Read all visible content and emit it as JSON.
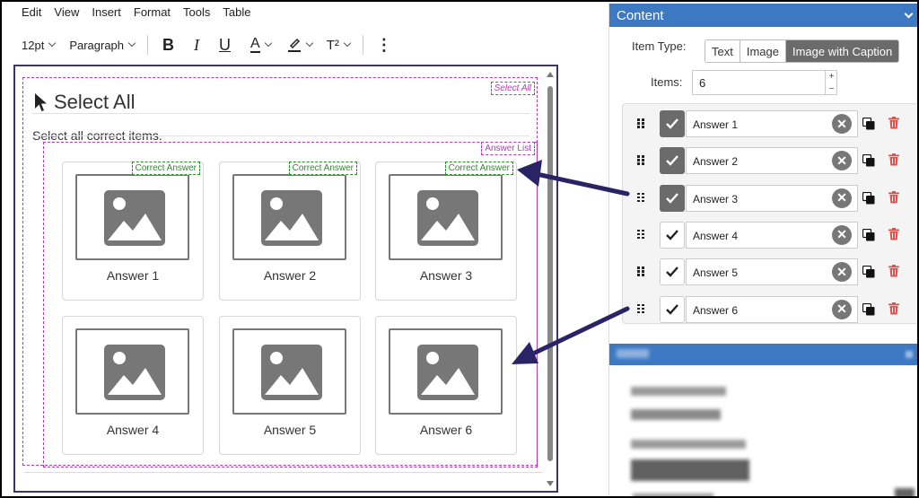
{
  "menu": [
    "Edit",
    "View",
    "Insert",
    "Format",
    "Tools",
    "Table"
  ],
  "toolbar": {
    "font_size": "12pt",
    "block_format": "Paragraph",
    "bold": "B",
    "italic": "I",
    "underline": "U",
    "font_color": "A",
    "superscript": "T²",
    "more": "⋮"
  },
  "editor": {
    "title": "Select All",
    "title_tag": "Select All",
    "prompt": "Select all correct items.",
    "list_tag": "Answer List",
    "correct_tag": "Correct Answer",
    "answers": [
      {
        "caption": "Answer 1",
        "correct": true
      },
      {
        "caption": "Answer 2",
        "correct": true
      },
      {
        "caption": "Answer 3",
        "correct": true
      },
      {
        "caption": "Answer 4",
        "correct": false
      },
      {
        "caption": "Answer 5",
        "correct": false
      },
      {
        "caption": "Answer 6",
        "correct": false
      }
    ]
  },
  "panel": {
    "title": "Content",
    "item_type_label": "Item Type:",
    "item_types": [
      "Text",
      "Image",
      "Image with Caption"
    ],
    "selected_type": "Image with Caption",
    "items_label": "Items:",
    "items_value": "6",
    "spin_up": "+",
    "spin_down": "−",
    "rows": [
      {
        "value": "Answer 1",
        "checked": true
      },
      {
        "value": "Answer 2",
        "checked": true
      },
      {
        "value": "Answer 3",
        "checked": true
      },
      {
        "value": "Answer 4",
        "checked": false
      },
      {
        "value": "Answer 5",
        "checked": false
      },
      {
        "value": "Answer 6",
        "checked": false
      }
    ],
    "clear_glyph": "✕"
  },
  "colors": {
    "accent": "#3d78c3",
    "editor_border": "#3c3470",
    "tag_pink": "#b23cb2",
    "tag_green": "#2e8b2e",
    "arrow": "#2a2466",
    "delete_red": "#d9534f"
  },
  "icons": [
    "pointer-icon",
    "image-placeholder-icon",
    "drag-handle-icon",
    "checkmark-icon",
    "clear-icon",
    "duplicate-icon",
    "trash-icon",
    "chevron-down-icon"
  ]
}
